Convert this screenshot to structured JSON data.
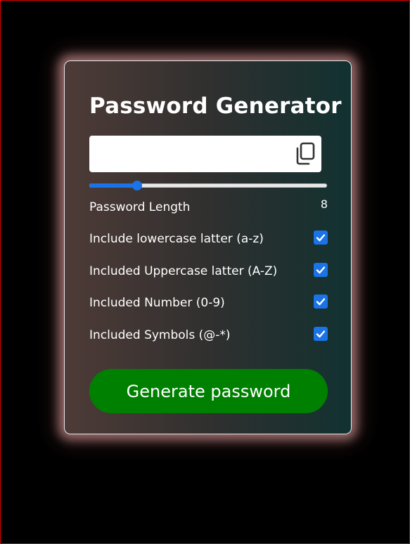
{
  "app": {
    "title": "Password Generator"
  },
  "password": {
    "value": "",
    "placeholder": ""
  },
  "length": {
    "label": "Password Length",
    "value": "8",
    "slider_fraction": 0.2
  },
  "options": [
    {
      "label": "Include lowercase latter (a-z)",
      "checked": true
    },
    {
      "label": "Included Uppercase latter (A-Z)",
      "checked": true
    },
    {
      "label": "Included Number (0-9)",
      "checked": true
    },
    {
      "label": "Included Symbols (@-*)",
      "checked": true
    }
  ],
  "actions": {
    "generate_label": "Generate password"
  },
  "icons": {
    "copy": "copy-icon",
    "check": "checkmark-icon"
  },
  "colors": {
    "page_background": "#000000",
    "page_border": "#e00000",
    "card_gradient_start": "#4e3b37",
    "card_gradient_end": "#123131",
    "card_glow": "#f0afaf",
    "accent": "#1a73e8",
    "generate_button": "#008000",
    "text": "#ffffff"
  }
}
